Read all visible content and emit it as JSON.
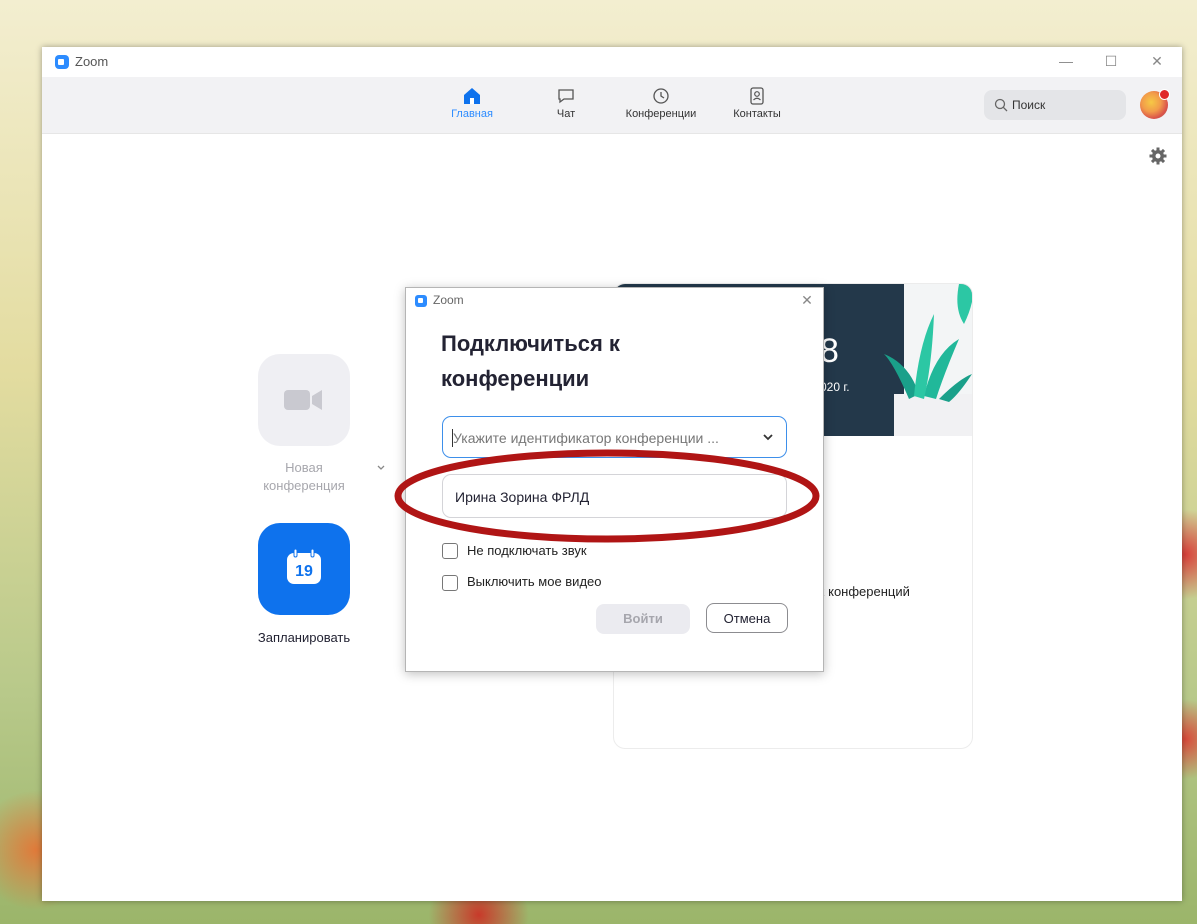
{
  "window": {
    "title": "Zoom",
    "controls": [
      "—",
      "☐",
      "✕"
    ]
  },
  "nav": {
    "tabs": [
      {
        "label": "Главная",
        "icon": "home-icon",
        "active": true
      },
      {
        "label": "Чат",
        "icon": "chat-icon",
        "active": false
      },
      {
        "label": "Конференции",
        "icon": "clock-icon",
        "active": false
      },
      {
        "label": "Контакты",
        "icon": "contacts-icon",
        "active": false
      }
    ],
    "search_label": "Поиск"
  },
  "home": {
    "new_meeting_label_line1": "Новая",
    "new_meeting_label_line2": "конференция",
    "schedule_label": "Запланировать",
    "calendar_day": "19",
    "card_clock_partial": "8",
    "card_date_partial": "020 г.",
    "card_text_partial": "х конференций"
  },
  "dialog": {
    "title": "Zoom",
    "heading_line1": "Подключиться к",
    "heading_line2": "конференции",
    "meeting_id_placeholder": "Укажите идентификатор конференции ...",
    "name_value": "Ирина Зорина ФРЛД",
    "option_no_audio": "Не подключать звук",
    "option_no_video": "Выключить мое видео",
    "join_label": "Войти",
    "cancel_label": "Отмена"
  },
  "colors": {
    "accent": "#2d8cff",
    "schedule_tile": "#0e72ed",
    "annotation": "#b01515"
  }
}
